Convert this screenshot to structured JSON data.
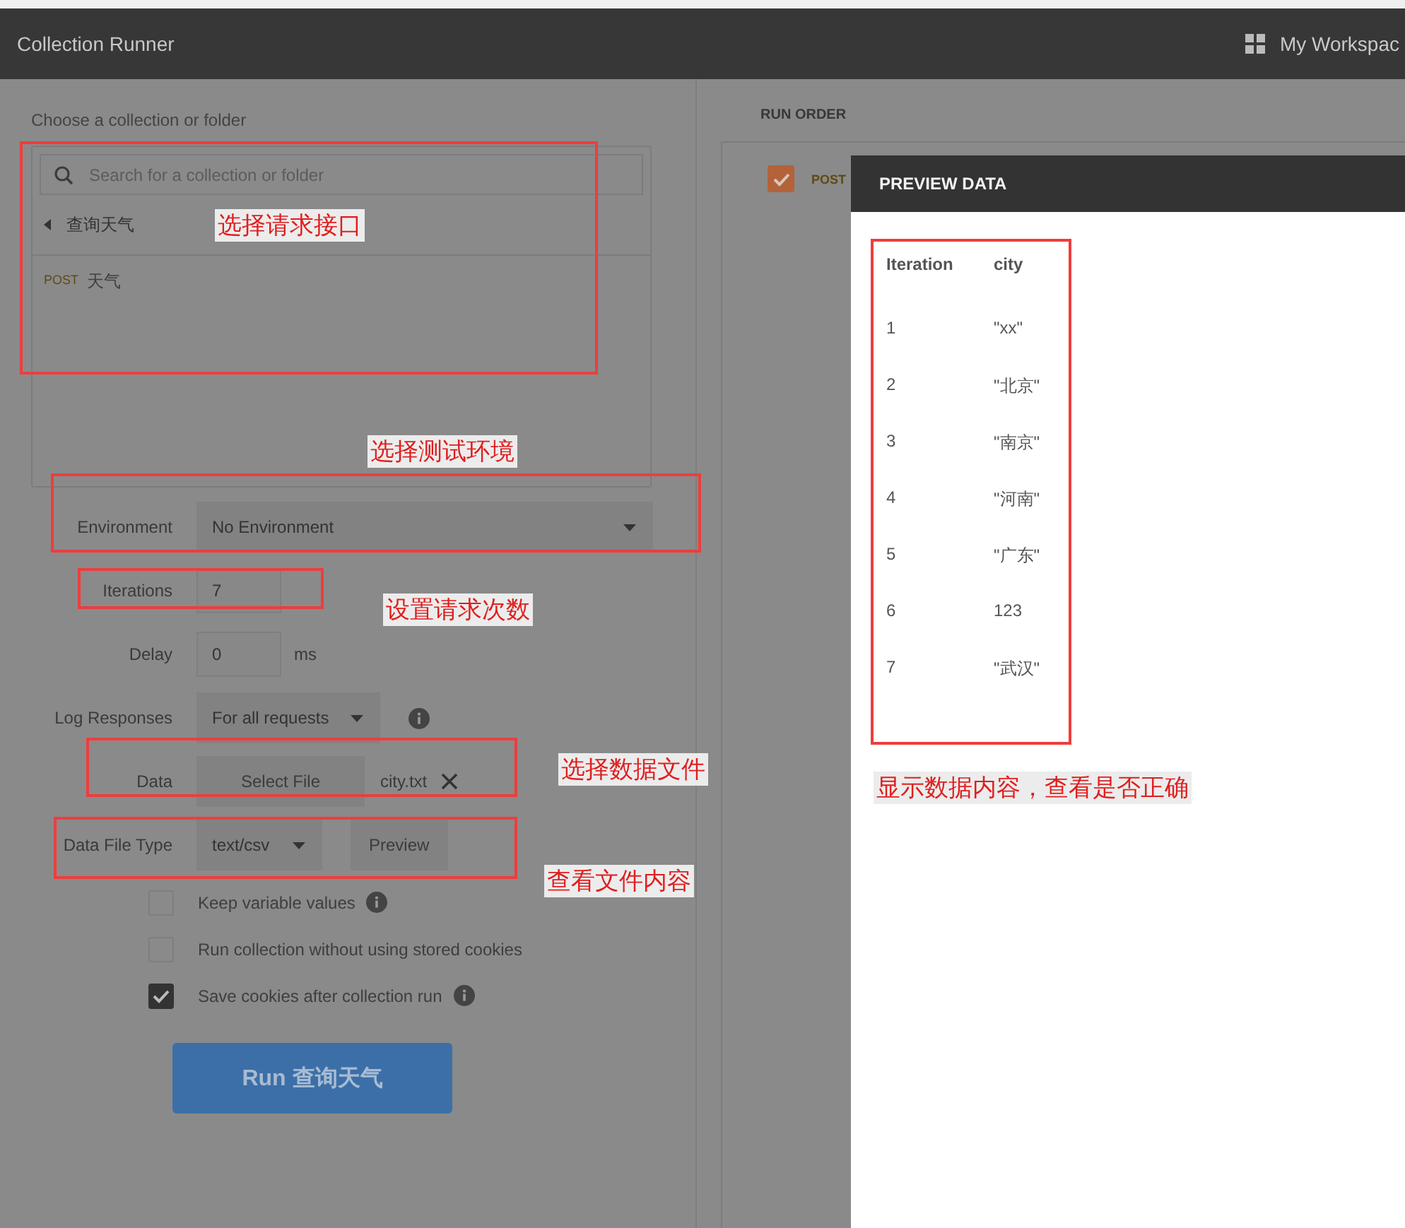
{
  "header": {
    "title": "Collection Runner",
    "workspace": "My Workspac"
  },
  "collection_picker": {
    "label": "Choose a collection or folder",
    "search": {
      "placeholder": "Search for a collection or folder"
    },
    "folder": "查询天气",
    "requests": [
      {
        "method": "POST",
        "name": "天气"
      }
    ]
  },
  "form": [
    {
      "kind": "select",
      "label": "Environment",
      "value": "No Environment"
    },
    {
      "kind": "input",
      "label": "Iterations",
      "value": "7"
    },
    {
      "kind": "input",
      "label": "Delay",
      "value": "0",
      "unit": "ms"
    },
    {
      "kind": "select",
      "label": "Log Responses",
      "value": "For all requests",
      "info": true
    },
    {
      "kind": "file",
      "label": "Data",
      "button": "Select File",
      "file": "city.txt"
    },
    {
      "kind": "select",
      "label": "Data File Type",
      "value": "text/csv",
      "button": "Preview"
    }
  ],
  "options": [
    {
      "label": "Keep variable values",
      "checked": false,
      "info": true
    },
    {
      "label": "Run collection without using stored cookies",
      "checked": false,
      "info": false
    },
    {
      "label": "Save cookies after collection run",
      "checked": true,
      "info": true
    }
  ],
  "run_button": "Run 查询天气",
  "run_order": {
    "title": "RUN ORDER",
    "items": [
      {
        "method": "POST",
        "checked": true
      }
    ]
  },
  "preview": {
    "title": "PREVIEW DATA",
    "columns": [
      "Iteration",
      "city"
    ],
    "rows": [
      [
        "1",
        "\"xx\""
      ],
      [
        "2",
        "\"北京\""
      ],
      [
        "3",
        "\"南京\""
      ],
      [
        "4",
        "\"河南\""
      ],
      [
        "5",
        "\"广东\""
      ],
      [
        "6",
        "123"
      ],
      [
        "7",
        "\"武汉\""
      ]
    ]
  },
  "annotations": [
    "选择请求接口",
    "选择测试环境",
    "设置请求次数",
    "选择数据文件",
    "查看文件内容",
    "显示数据内容，查看是否正确"
  ]
}
